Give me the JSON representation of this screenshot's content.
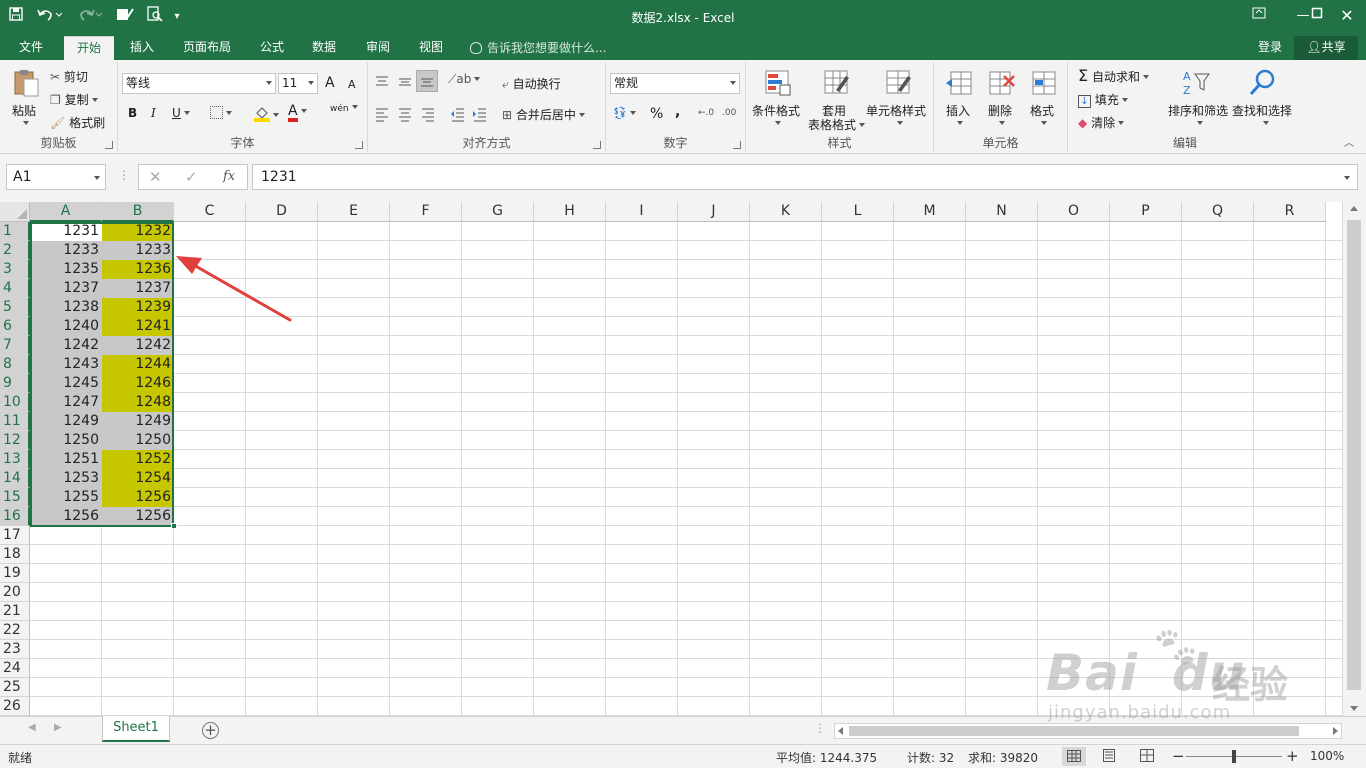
{
  "window": {
    "title": "数据2.xlsx - Excel"
  },
  "colors": {
    "accent": "#217346",
    "highlight": "#c7c700",
    "gray_fill": "#c8c8c8",
    "arrow": "#e0403c"
  },
  "tabs": [
    {
      "label": "文件"
    },
    {
      "label": "开始"
    },
    {
      "label": "插入"
    },
    {
      "label": "页面布局"
    },
    {
      "label": "公式"
    },
    {
      "label": "数据"
    },
    {
      "label": "审阅"
    },
    {
      "label": "视图"
    }
  ],
  "tellme": "告诉我您想要做什么...",
  "account": {
    "login": "登录",
    "share": "共享"
  },
  "ribbon": {
    "clipboard": {
      "paste": "粘贴",
      "cut": "剪切",
      "copy": "复制",
      "painter": "格式刷",
      "label": "剪贴板"
    },
    "font": {
      "name": "等线",
      "size": "11",
      "grow": "A",
      "shrink": "A",
      "bold": "B",
      "italic": "I",
      "underline": "U",
      "color_letter": "A",
      "phonetic": "wén",
      "label": "字体"
    },
    "alignment": {
      "wrap": "自动换行",
      "merge": "合并后居中",
      "label": "对齐方式"
    },
    "number": {
      "format": "常规",
      "percent": "%",
      "comma": ",",
      "label": "数字"
    },
    "styles": {
      "conditional": "条件格式",
      "table": "套用",
      "table2": "表格格式",
      "cell_styles": "单元格样式",
      "label": "样式"
    },
    "cells": {
      "insert": "插入",
      "delete": "删除",
      "format": "格式",
      "label": "单元格"
    },
    "editing": {
      "autosum": "自动求和",
      "fill": "填充",
      "clear": "清除",
      "sort": "排序和筛选",
      "find": "查找和选择",
      "label": "编辑"
    }
  },
  "formula_bar": {
    "name_box": "A1",
    "fx": "fx",
    "value": "1231"
  },
  "columns": [
    "A",
    "B",
    "C",
    "D",
    "E",
    "F",
    "G",
    "H",
    "I",
    "J",
    "K",
    "L",
    "M",
    "N",
    "O",
    "P",
    "Q",
    "R"
  ],
  "rows": [
    "1",
    "2",
    "3",
    "4",
    "5",
    "6",
    "7",
    "8",
    "9",
    "10",
    "11",
    "12",
    "13",
    "14",
    "15",
    "16",
    "17",
    "18",
    "19",
    "20",
    "21",
    "22",
    "23",
    "24",
    "25",
    "26"
  ],
  "data": [
    {
      "a": "1231",
      "b": "1232",
      "hl": true
    },
    {
      "a": "1233",
      "b": "1233",
      "hl": false
    },
    {
      "a": "1235",
      "b": "1236",
      "hl": true
    },
    {
      "a": "1237",
      "b": "1237",
      "hl": false
    },
    {
      "a": "1238",
      "b": "1239",
      "hl": true
    },
    {
      "a": "1240",
      "b": "1241",
      "hl": true
    },
    {
      "a": "1242",
      "b": "1242",
      "hl": false
    },
    {
      "a": "1243",
      "b": "1244",
      "hl": true
    },
    {
      "a": "1245",
      "b": "1246",
      "hl": true
    },
    {
      "a": "1247",
      "b": "1248",
      "hl": true
    },
    {
      "a": "1249",
      "b": "1249",
      "hl": false
    },
    {
      "a": "1250",
      "b": "1250",
      "hl": false
    },
    {
      "a": "1251",
      "b": "1252",
      "hl": true
    },
    {
      "a": "1253",
      "b": "1254",
      "hl": true
    },
    {
      "a": "1255",
      "b": "1256",
      "hl": true
    },
    {
      "a": "1256",
      "b": "1256",
      "hl": false
    }
  ],
  "sheet": {
    "name": "Sheet1",
    "add": "+"
  },
  "status": {
    "ready": "就绪",
    "average": "平均值: 1244.375",
    "count": "计数: 32",
    "sum": "求和: 39820",
    "zoom": "100%"
  },
  "watermark": {
    "brand": "Bai",
    "brand2": "du",
    "cn": "经验",
    "url": "jingyan.baidu.com"
  }
}
